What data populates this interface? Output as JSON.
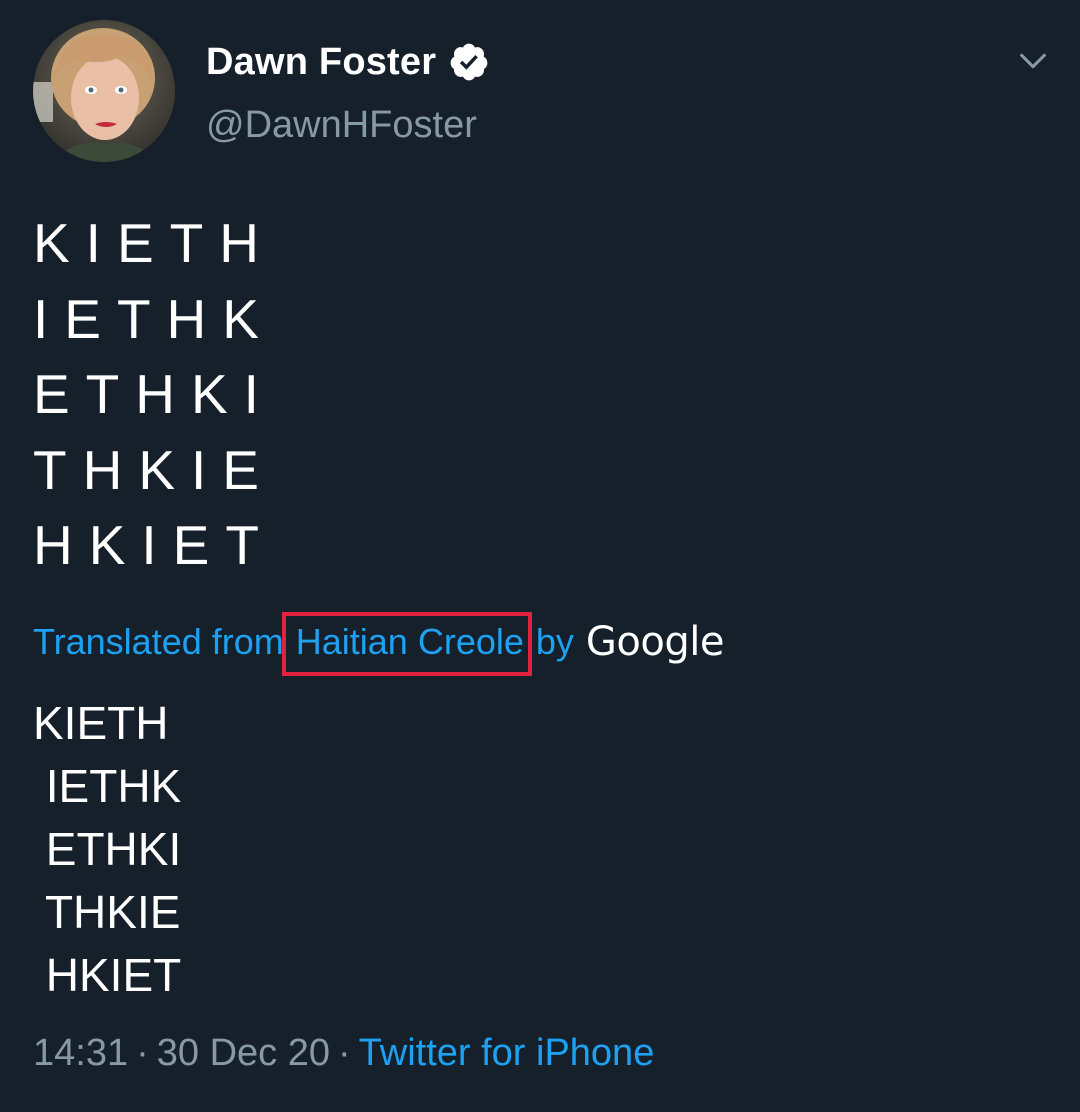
{
  "author": {
    "display_name": "Dawn Foster",
    "handle": "@DawnHFoster",
    "verified": true,
    "avatar_icon": "user-avatar-photo"
  },
  "menu": {
    "icon": "chevron-down-icon"
  },
  "tweet": {
    "lines": [
      "KIETH",
      "IETHK",
      "ETHKI",
      "THKIE",
      "HKIET"
    ]
  },
  "translation": {
    "prefix": "Translated from",
    "language": "Haitian Creole",
    "by": "by",
    "provider": "Google",
    "lines": [
      "KIETH",
      " IETHK",
      " ETHKI",
      " THKIE",
      " HKIET"
    ]
  },
  "meta": {
    "time": "14:31",
    "separator": "·",
    "date": "30 Dec 20",
    "source": "Twitter for iPhone"
  },
  "colors": {
    "background": "#15202b",
    "link": "#1da1f2",
    "secondary": "#8899a6",
    "highlight": "#e0223f"
  }
}
